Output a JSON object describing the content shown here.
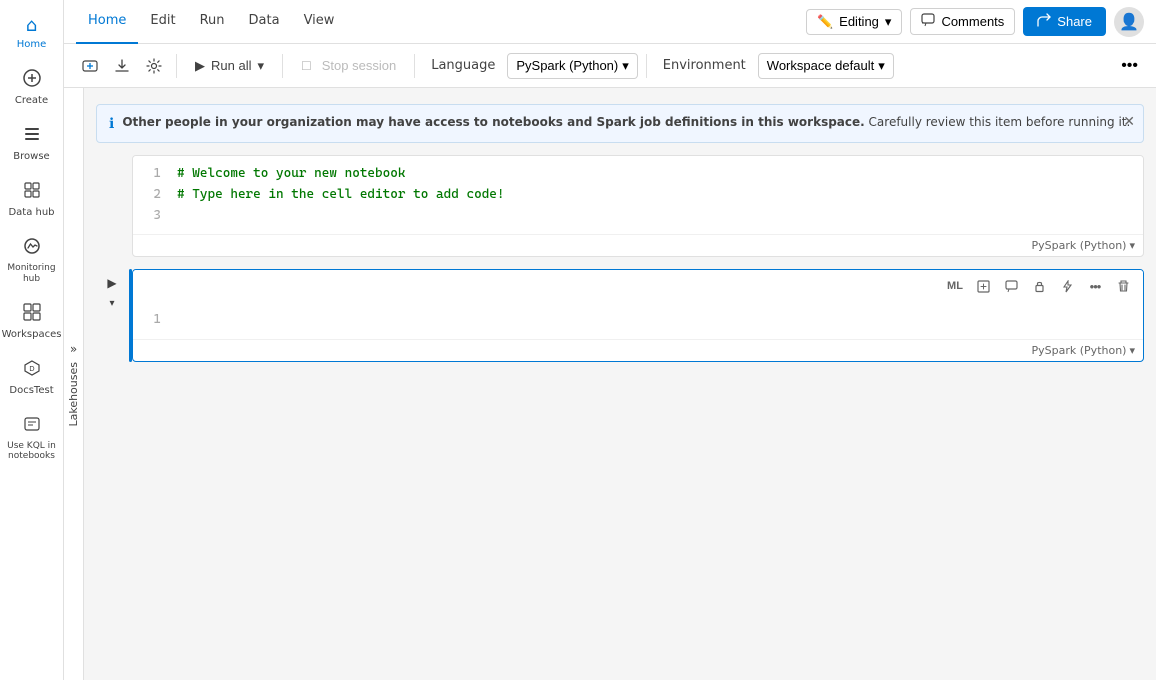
{
  "sidebar": {
    "items": [
      {
        "id": "home",
        "label": "Home",
        "icon": "⌂",
        "active": true
      },
      {
        "id": "create",
        "label": "Create",
        "icon": "+",
        "active": false
      },
      {
        "id": "browse",
        "label": "Browse",
        "icon": "☰",
        "active": false
      },
      {
        "id": "datahub",
        "label": "Data hub",
        "icon": "◫",
        "active": false
      },
      {
        "id": "monitoring",
        "label": "Monitoring hub",
        "icon": "◉",
        "active": false
      },
      {
        "id": "workspaces",
        "label": "Workspaces",
        "icon": "⬜",
        "active": false
      },
      {
        "id": "docstest",
        "label": "DocsTest",
        "icon": "⬡",
        "active": false
      },
      {
        "id": "kql",
        "label": "Use KQL in notebooks",
        "icon": "≡",
        "active": false
      }
    ]
  },
  "topnav": {
    "menu_items": [
      {
        "id": "home",
        "label": "Home",
        "active": true
      },
      {
        "id": "edit",
        "label": "Edit",
        "active": false
      },
      {
        "id": "run",
        "label": "Run",
        "active": false
      },
      {
        "id": "data",
        "label": "Data",
        "active": false
      },
      {
        "id": "view",
        "label": "View",
        "active": false
      }
    ],
    "editing_label": "Editing",
    "editing_dropdown": "▾",
    "comments_label": "Comments",
    "share_label": "Share"
  },
  "toolbar": {
    "run_all_label": "Run all",
    "stop_label": "Stop session",
    "language_label": "Language",
    "language_value": "PySpark (Python)",
    "environment_label": "Environment",
    "environment_value": "Workspace default"
  },
  "info_banner": {
    "text_bold": "Other people in your organization may have access to notebooks and Spark job definitions in this workspace.",
    "text_regular": " Carefully review this item before running it."
  },
  "lakehouse": {
    "label": "Lakehouses"
  },
  "cells": [
    {
      "id": "cell1",
      "lines": [
        {
          "num": "1",
          "content": "# Welcome to your new notebook"
        },
        {
          "num": "2",
          "content": "# Type here in the cell editor to add code!"
        },
        {
          "num": "3",
          "content": ""
        }
      ],
      "lang": "PySpark (Python)",
      "active": false
    },
    {
      "id": "cell2",
      "lines": [
        {
          "num": "1",
          "content": ""
        }
      ],
      "lang": "PySpark (Python)",
      "active": true
    }
  ]
}
